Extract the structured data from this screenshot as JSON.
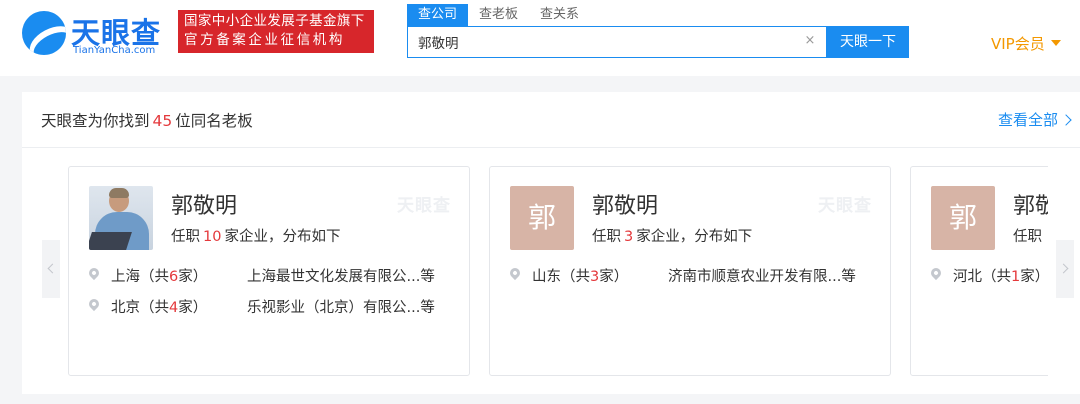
{
  "header": {
    "logo_name": "天眼查",
    "logo_sub": "TianYanCha.com",
    "badge_line1": "国家中小企业发展子基金旗下",
    "badge_line2": "官方备案企业征信机构",
    "tabs": [
      {
        "label": "查公司",
        "active": true
      },
      {
        "label": "查老板",
        "active": false
      },
      {
        "label": "查关系",
        "active": false
      }
    ],
    "search_value": "郭敬明",
    "clear_glyph": "×",
    "search_button": "天眼一下",
    "vip_label": "VIP会员"
  },
  "result": {
    "prefix": "天眼查为你找到",
    "count": "45",
    "suffix": "位同名老板",
    "view_all": "查看全部"
  },
  "cards": [
    {
      "avatar_type": "photo",
      "avatar_char": "",
      "name": "郭敬明",
      "summary_prefix": "任职",
      "summary_count": "10",
      "summary_suffix": "家企业，分布如下",
      "watermark": "天眼查",
      "locations": [
        {
          "region_prefix": "上海（共",
          "count": "6",
          "region_suffix": "家）",
          "company": "上海最世文化发展有限公...等"
        },
        {
          "region_prefix": "北京（共",
          "count": "4",
          "region_suffix": "家）",
          "company": "乐视影业（北京）有限公...等"
        }
      ]
    },
    {
      "avatar_type": "char",
      "avatar_char": "郭",
      "name": "郭敬明",
      "summary_prefix": "任职",
      "summary_count": "3",
      "summary_suffix": "家企业，分布如下",
      "watermark": "天眼查",
      "locations": [
        {
          "region_prefix": "山东（共",
          "count": "3",
          "region_suffix": "家）",
          "company": "济南市顺意农业开发有限...等"
        }
      ]
    },
    {
      "avatar_type": "char",
      "avatar_char": "郭",
      "name": "郭敬",
      "summary_prefix": "任职",
      "summary_count": "",
      "summary_suffix": "",
      "watermark": "",
      "locations": [
        {
          "region_prefix": "河北（共",
          "count": "1",
          "region_suffix": "家）",
          "company": ""
        }
      ]
    }
  ],
  "colors": {
    "brand_blue": "#1a8cf0",
    "badge_red": "#d7262b",
    "highlight_red": "#e4393c",
    "vip_orange": "#f39800",
    "avatar_bg": "#d7b4a6"
  },
  "icons": {
    "logo": "eye-swoosh-icon",
    "clear": "close-icon",
    "location": "map-pin-icon",
    "prev": "chevron-left-icon",
    "next": "chevron-right-icon",
    "vip_caret": "caret-down-icon",
    "view_all": "chevron-right-icon"
  }
}
